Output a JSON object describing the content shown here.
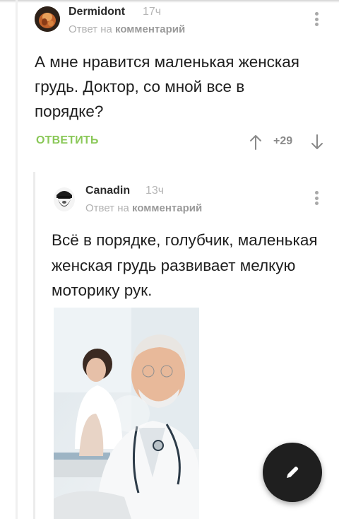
{
  "comment": {
    "author": "Dermidont",
    "time": "17ч",
    "reply_prefix": "Ответ на",
    "reply_target": "комментарий",
    "text": "А мне нравится маленькая женская грудь. Доктор, со мной все в порядке?",
    "reply_button": "ОТВЕТИТЬ",
    "rating": "+29"
  },
  "reply": {
    "author": "Canadin",
    "time": "13ч",
    "reply_prefix": "Ответ на",
    "reply_target": "комментарий",
    "text": "Всё в порядке, голубчик, маленькая женская грудь развивает мелкую моторику рук."
  },
  "icons": {
    "up": "arrow-up-icon",
    "down": "arrow-down-icon",
    "menu": "more-vertical-icon",
    "fab": "pencil-icon"
  },
  "colors": {
    "accent_green": "#8ac858",
    "fab_bg": "#1f1f1f",
    "muted": "#b0b0b0"
  }
}
